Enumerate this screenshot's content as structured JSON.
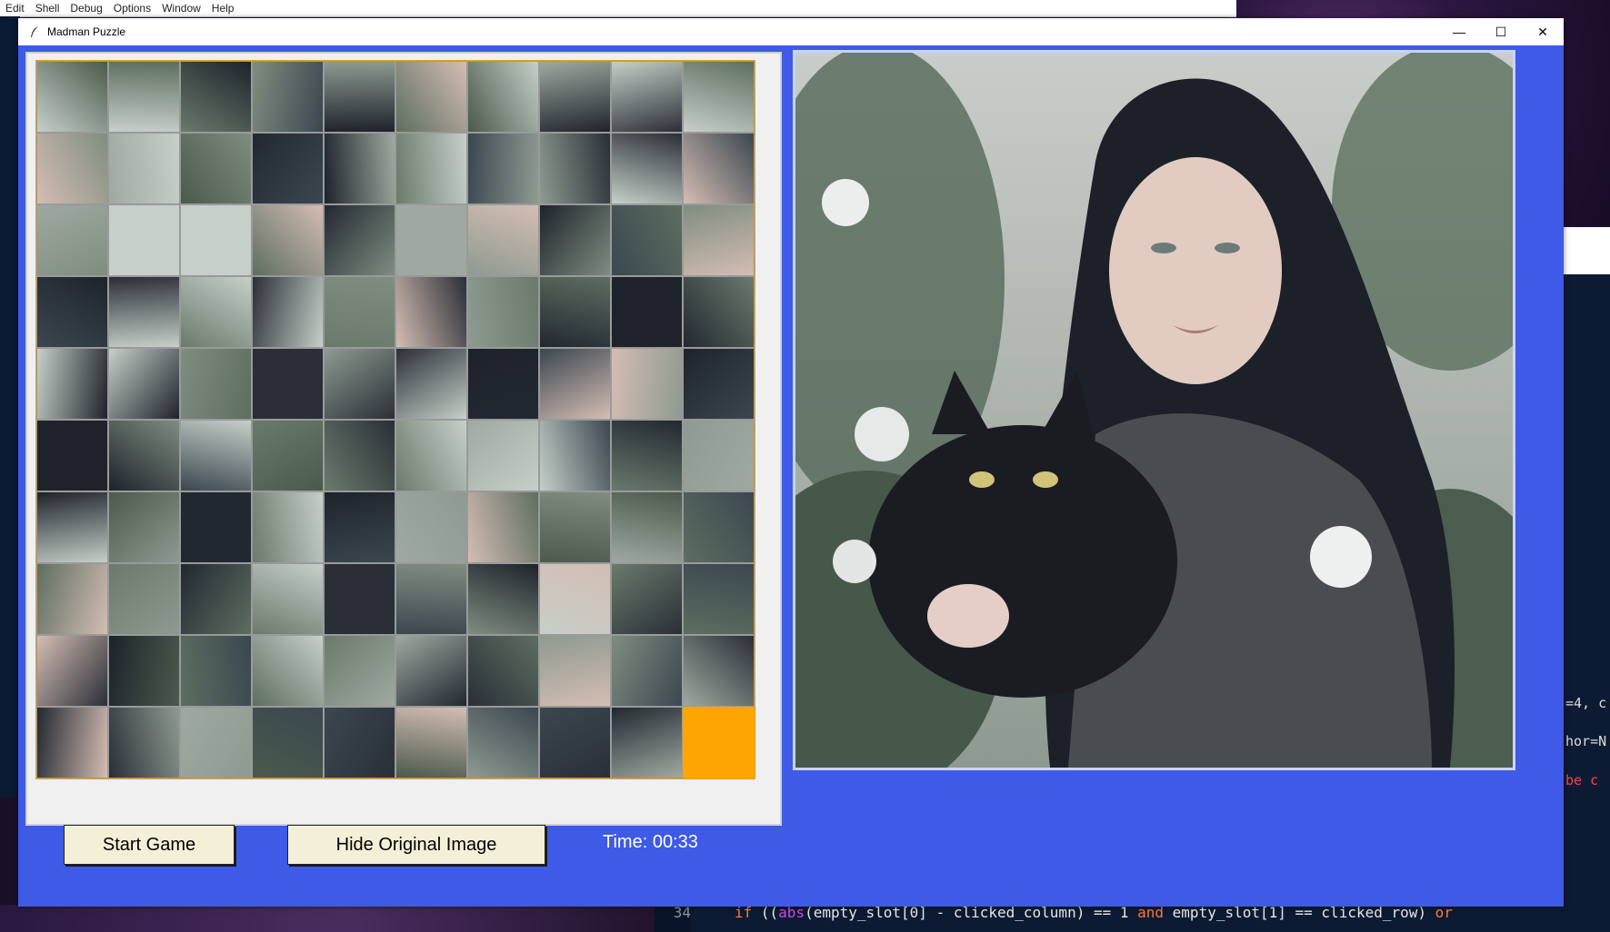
{
  "menubar": {
    "items": [
      "Edit",
      "Shell",
      "Debug",
      "Options",
      "Window",
      "Help"
    ]
  },
  "window": {
    "title": "Madman Puzzle",
    "controls": {
      "minimize": "—",
      "maximize": "☐",
      "close": "✕"
    }
  },
  "puzzle": {
    "rows": 10,
    "cols": 10,
    "empty_tile": {
      "row": 10,
      "col": 10
    },
    "empty_color": "#ffa500"
  },
  "buttons": {
    "start_label": "Start Game",
    "hide_label": "Hide Original Image"
  },
  "timer": {
    "text": "Time: 00:33"
  },
  "background_editor": {
    "right_fragments": [
      "=4, c",
      "hor=N",
      "be c"
    ],
    "line_number": "34",
    "code_line": [
      "if",
      "((",
      "abs",
      "(empty_slot[0] - clicked_column) == 1 ",
      "and",
      " empty_slot[1] == clicked_row) ",
      "or"
    ]
  },
  "colors": {
    "window_bg": "#3e5ae6",
    "button_bg": "#f4f0d7",
    "empty_tile": "#ffa500"
  }
}
